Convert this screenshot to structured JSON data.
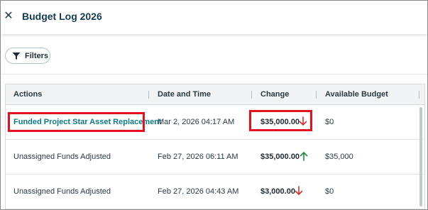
{
  "header": {
    "title": "Budget Log 2026",
    "close_icon": "close-icon"
  },
  "toolbar": {
    "filters_label": "Filters",
    "filters_icon": "filter-icon"
  },
  "table": {
    "columns": [
      "Actions",
      "Date and Time",
      "Change",
      "Available Budget"
    ],
    "rows": [
      {
        "action": "Funded Project Star Asset Replacement",
        "action_is_link": true,
        "date": "Mar 2, 2026 04:17 AM",
        "change": "$35,000.00",
        "direction": "down",
        "available": "$0"
      },
      {
        "action": "Unassigned Funds Adjusted",
        "action_is_link": false,
        "date": "Feb 27, 2026 06:11 AM",
        "change": "$35,000.00",
        "direction": "up",
        "available": "$35,000"
      },
      {
        "action": "Unassigned Funds Adjusted",
        "action_is_link": false,
        "date": "Feb 27, 2026 04:43 AM",
        "change": "$3,000.00",
        "direction": "down",
        "available": "$0"
      }
    ]
  },
  "colors": {
    "link": "#0e7a86",
    "down_arrow": "#d0312d",
    "up_arrow": "#1e8a3c",
    "highlight": "#e0121e",
    "title": "#123a52"
  }
}
